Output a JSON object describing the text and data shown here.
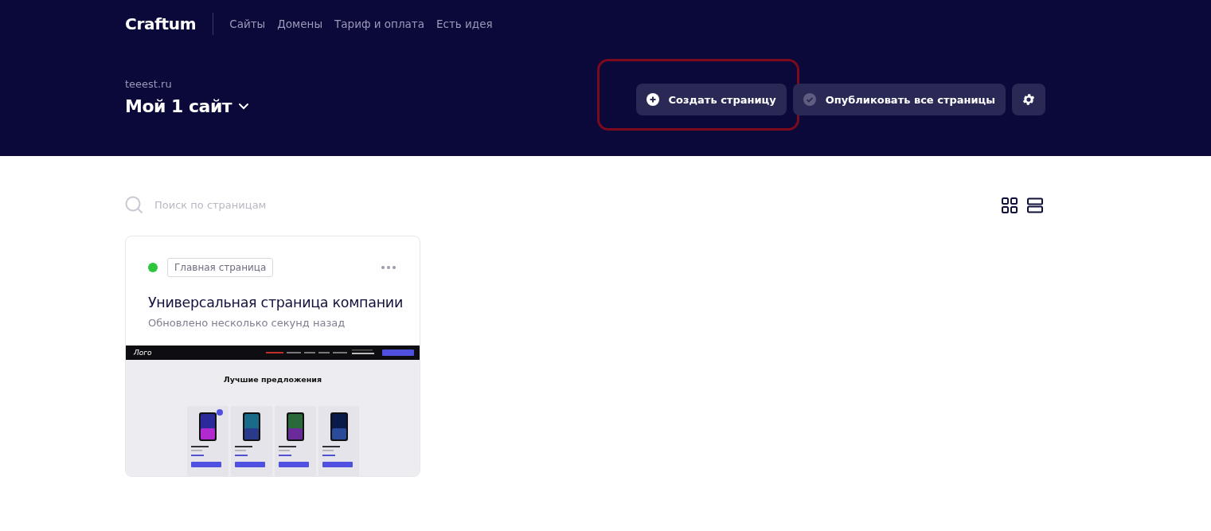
{
  "brand": "Craftum",
  "nav": [
    {
      "label": "Сайты"
    },
    {
      "label": "Домены"
    },
    {
      "label": "Тариф и оплата"
    },
    {
      "label": "Есть идея"
    }
  ],
  "site": {
    "domain": "teeest.ru",
    "title": "Мой 1 сайт"
  },
  "actions": [
    {
      "kind": "create",
      "label": "Создать страницу",
      "highlighted": true
    },
    {
      "kind": "publish",
      "label": "Опубликовать все страницы",
      "highlighted": false
    },
    {
      "kind": "settings",
      "highlighted": false
    }
  ],
  "search": {
    "placeholder": "Поиск по страницам"
  },
  "view_modes": [
    {
      "kind": "grid",
      "selected": false
    },
    {
      "kind": "list",
      "selected": false
    }
  ],
  "pages": [
    {
      "published": true,
      "tag": "Главная страница",
      "title": "Универсальная страница компании",
      "updated": "Обновлено несколько секунд назад",
      "preview": {
        "logo": "Лого",
        "heading": "Лучшие предложения"
      }
    }
  ]
}
